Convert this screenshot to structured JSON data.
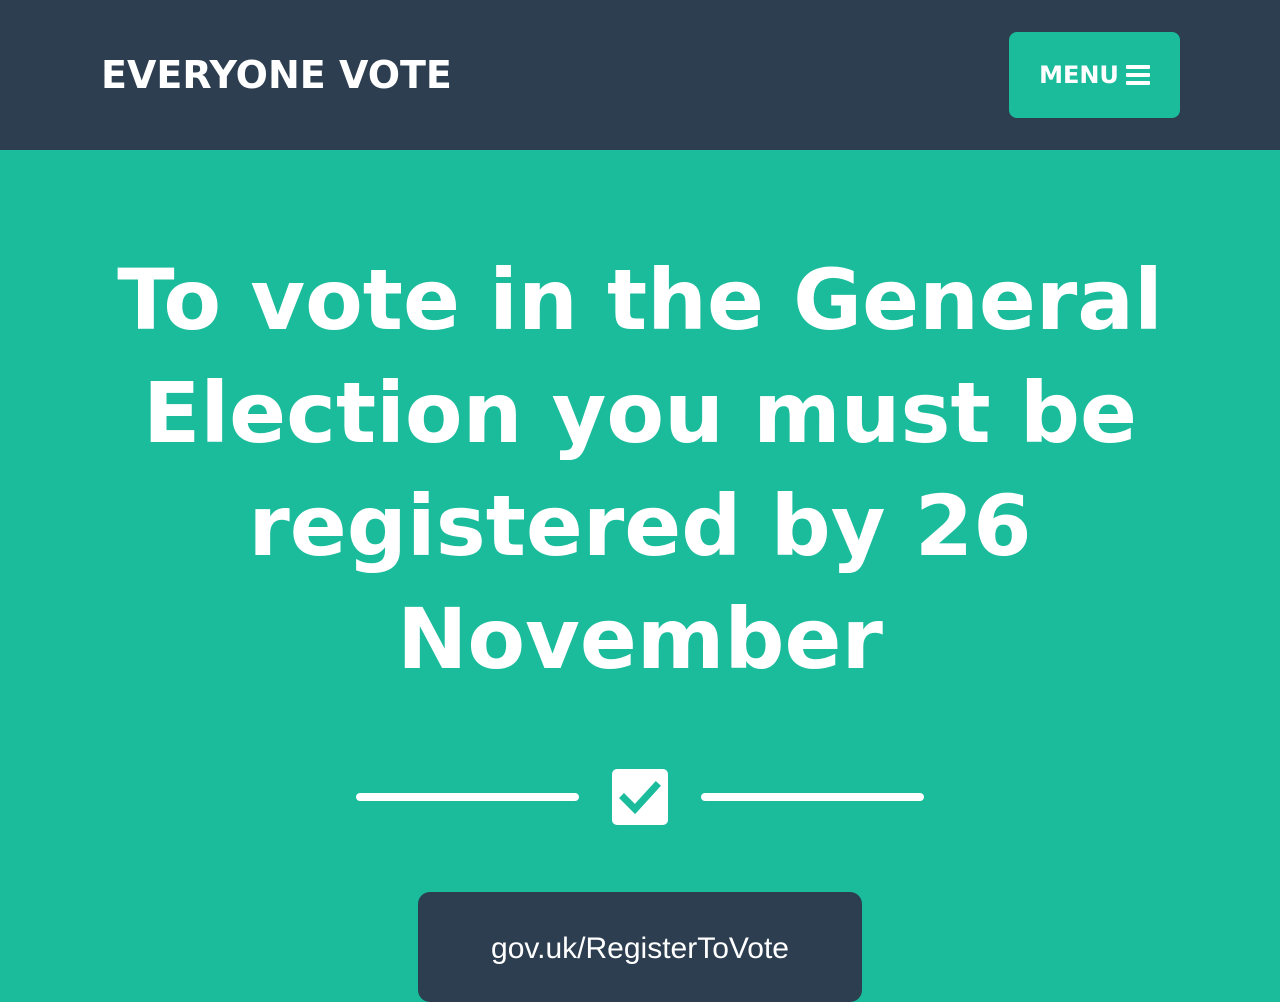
{
  "header": {
    "brand": "EVERYONE VOTE",
    "menu_label": "MENU",
    "menu_icon": "bars-icon"
  },
  "hero": {
    "headline": "To vote in the General Election you must be registered by 26 November",
    "divider_icon": "check-square-icon"
  },
  "cta": {
    "link_text": "gov.uk/RegisterToVote"
  },
  "colors": {
    "primary": "#1abc9c",
    "dark": "#2c3e50",
    "text": "#ffffff"
  }
}
